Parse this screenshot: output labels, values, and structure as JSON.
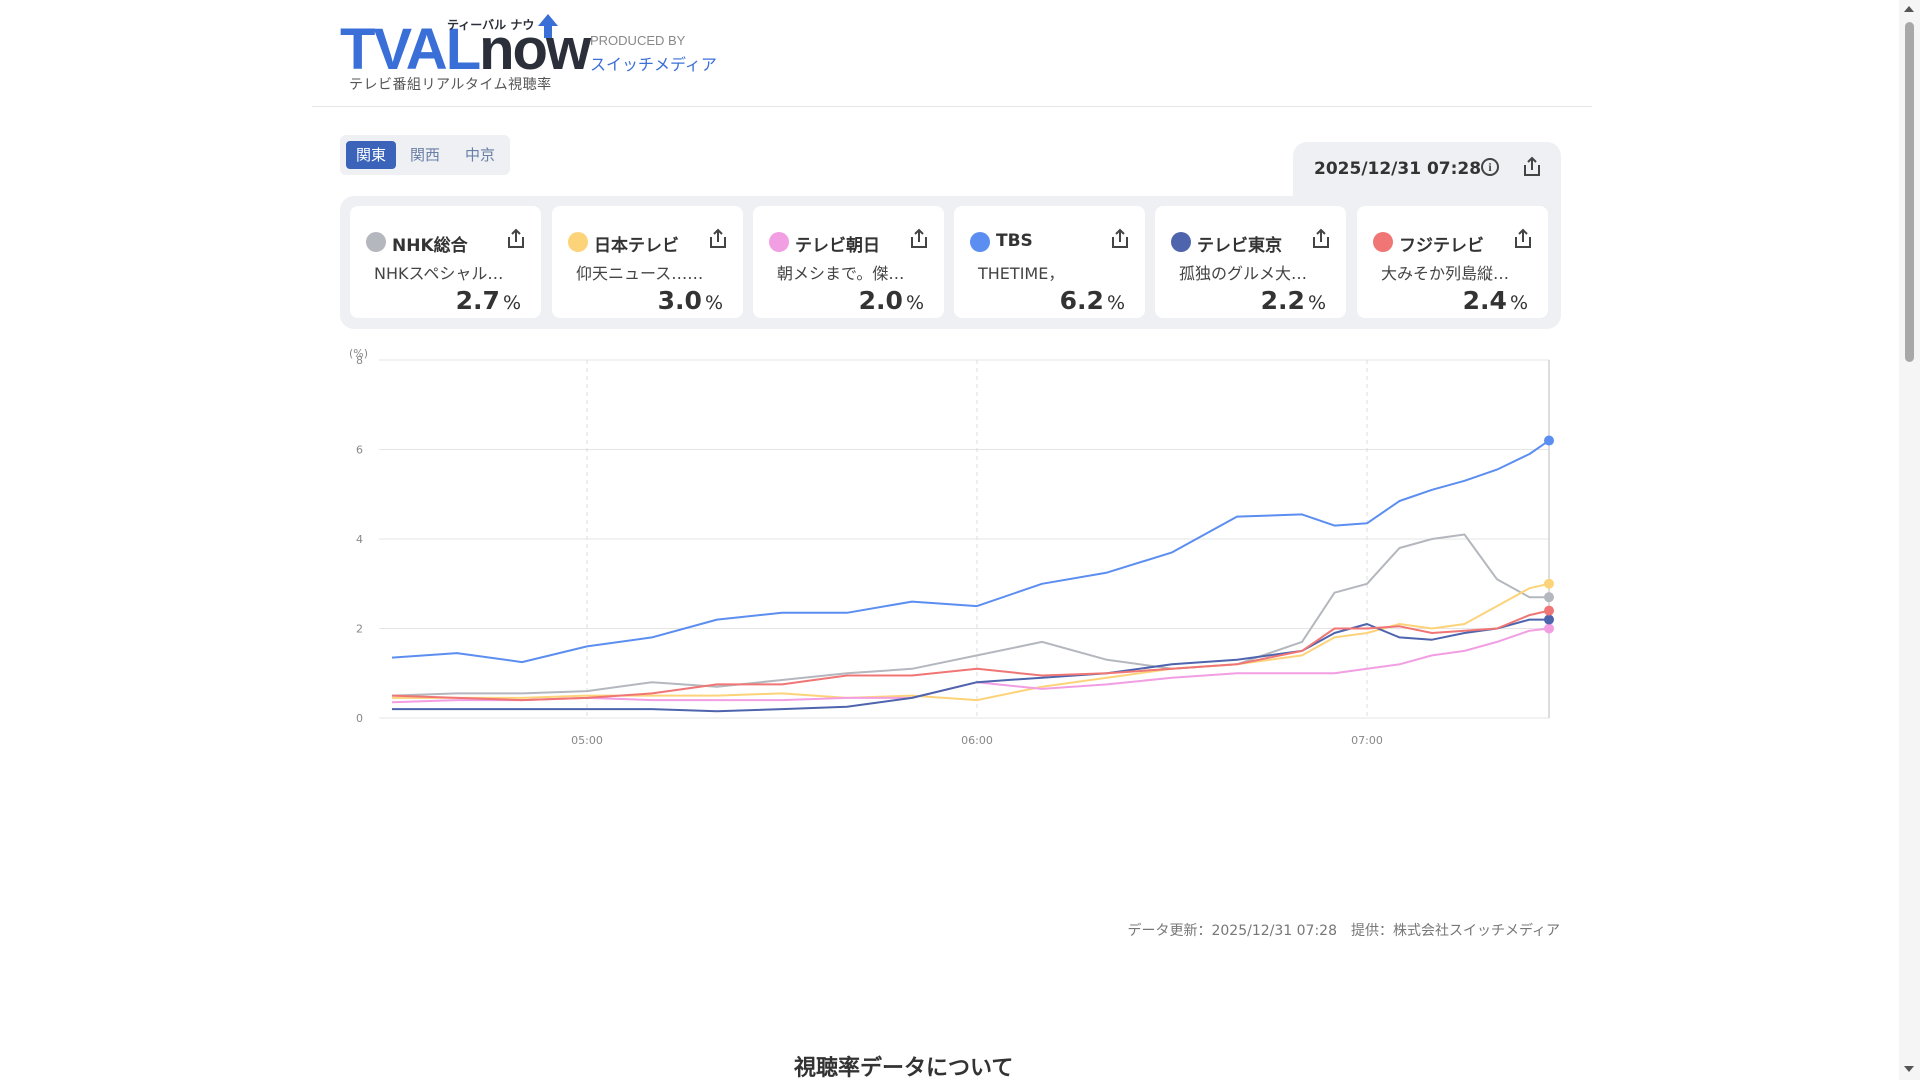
{
  "brand": {
    "logo_main_a": "TVAL",
    "logo_main_b": "now",
    "logo_kana": "ティーバル ナウ",
    "logo_sub": "テレビ番組リアルタイム視聴率",
    "produced_by": "PRODUCED BY",
    "producer": "スイッチメディア"
  },
  "regions": [
    {
      "label": "関東",
      "active": true
    },
    {
      "label": "関西",
      "active": false
    },
    {
      "label": "中京",
      "active": false
    }
  ],
  "datetime": "2025/12/31 07:28",
  "icons": {
    "info": "info-icon",
    "share": "share-icon"
  },
  "channels": [
    {
      "name": "NHK総合",
      "program": "NHKスペシャル…",
      "rating": "2.7",
      "unit": "%",
      "color": "#b4b7be"
    },
    {
      "name": "日本テレビ",
      "program": "仰天ニュース……",
      "rating": "3.0",
      "unit": "%",
      "color": "#fdd37a"
    },
    {
      "name": "テレビ朝日",
      "program": "朝メシまで。傑…",
      "rating": "2.0",
      "unit": "%",
      "color": "#f29ee3"
    },
    {
      "name": "TBS",
      "program": "THETIME，",
      "rating": "6.2",
      "unit": "%",
      "color": "#5b8ef0"
    },
    {
      "name": "テレビ東京",
      "program": "孤独のグルメ大…",
      "rating": "2.2",
      "unit": "%",
      "color": "#4e64ad"
    },
    {
      "name": "フジテレビ",
      "program": "大みそか列島縦…",
      "rating": "2.4",
      "unit": "%",
      "color": "#f07575"
    }
  ],
  "chart_data": {
    "type": "line",
    "ylabel": "(%)",
    "ylim": [
      0,
      8
    ],
    "yticks": [
      "0",
      "2",
      "4",
      "6",
      "8"
    ],
    "xlim": [
      "04:28",
      "07:28"
    ],
    "xticks": [
      "05:00",
      "06:00",
      "07:00"
    ],
    "grid": true,
    "x": [
      "04:30",
      "04:40",
      "04:50",
      "05:00",
      "05:10",
      "05:20",
      "05:30",
      "05:40",
      "05:50",
      "06:00",
      "06:10",
      "06:20",
      "06:30",
      "06:40",
      "06:50",
      "06:55",
      "07:00",
      "07:05",
      "07:10",
      "07:15",
      "07:20",
      "07:25",
      "07:28"
    ],
    "series": [
      {
        "name": "NHK総合",
        "color": "#b4b7be",
        "values": [
          0.5,
          0.55,
          0.55,
          0.6,
          0.8,
          0.7,
          0.85,
          1.0,
          1.1,
          1.4,
          1.7,
          1.3,
          1.1,
          1.2,
          1.7,
          2.8,
          3.0,
          3.8,
          4.0,
          4.1,
          3.1,
          2.7,
          2.7
        ]
      },
      {
        "name": "日本テレビ",
        "color": "#fdd37a",
        "values": [
          0.45,
          0.45,
          0.45,
          0.5,
          0.5,
          0.5,
          0.55,
          0.45,
          0.5,
          0.4,
          0.7,
          0.9,
          1.1,
          1.2,
          1.4,
          1.8,
          1.9,
          2.1,
          2.0,
          2.1,
          2.5,
          2.9,
          3.0
        ]
      },
      {
        "name": "テレビ朝日",
        "color": "#f29ee3",
        "values": [
          0.35,
          0.4,
          0.4,
          0.45,
          0.4,
          0.4,
          0.4,
          0.45,
          0.45,
          0.8,
          0.65,
          0.75,
          0.9,
          1.0,
          1.0,
          1.0,
          1.1,
          1.2,
          1.4,
          1.5,
          1.7,
          1.95,
          2.0
        ]
      },
      {
        "name": "TBS",
        "color": "#5b8ef0",
        "values": [
          1.35,
          1.45,
          1.25,
          1.6,
          1.8,
          2.2,
          2.35,
          2.35,
          2.6,
          2.5,
          3.0,
          3.25,
          3.7,
          4.5,
          4.55,
          4.3,
          4.35,
          4.85,
          5.1,
          5.3,
          5.55,
          5.9,
          6.2
        ]
      },
      {
        "name": "テレビ東京",
        "color": "#4e64ad",
        "values": [
          0.2,
          0.2,
          0.2,
          0.2,
          0.2,
          0.15,
          0.2,
          0.25,
          0.45,
          0.8,
          0.9,
          1.0,
          1.2,
          1.3,
          1.5,
          1.9,
          2.1,
          1.8,
          1.75,
          1.9,
          2.0,
          2.2,
          2.2
        ]
      },
      {
        "name": "フジテレビ",
        "color": "#f07575",
        "values": [
          0.5,
          0.45,
          0.4,
          0.45,
          0.55,
          0.75,
          0.75,
          0.95,
          0.95,
          1.1,
          0.95,
          1.0,
          1.1,
          1.2,
          1.5,
          2.0,
          2.0,
          2.05,
          1.9,
          1.95,
          2.0,
          2.3,
          2.4
        ]
      }
    ]
  },
  "footer": {
    "note": "データ更新：2025/12/31 07:28　提供：株式会社スイッチメディア"
  },
  "section": {
    "title": "視聴率データについて"
  }
}
